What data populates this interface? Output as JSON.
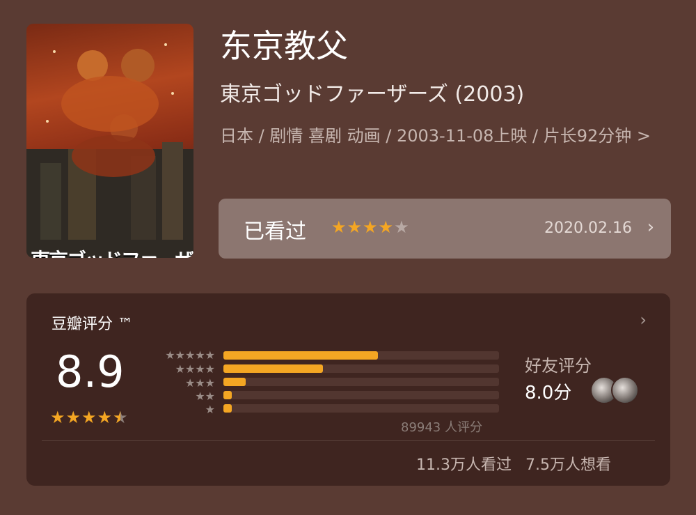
{
  "movie": {
    "title": "东京教父",
    "original_title": "東京ゴッドファーザーズ (2003)",
    "meta": "日本 / 剧情 喜剧 动画 / 2003-11-08上映 / 片长92分钟 >",
    "poster_title": "東京ゴッドファーザーズ"
  },
  "watched": {
    "label": "已看过",
    "stars": 4,
    "date": "2020.02.16",
    "chevron": "›"
  },
  "rating": {
    "title": "豆瓣评分 ™",
    "score": "8.9",
    "stars": 4.5,
    "chevron": "›",
    "distribution": [
      {
        "stars": "★★★★★",
        "fraction": 0.56
      },
      {
        "stars": "★★★★",
        "fraction": 0.36
      },
      {
        "stars": "★★★",
        "fraction": 0.08
      },
      {
        "stars": "★★",
        "fraction": 0.03
      },
      {
        "stars": "★",
        "fraction": 0.03
      }
    ],
    "count": "89943 人评分",
    "friends_label": "好友评分",
    "friends_score": "8.0分",
    "watched_count": "11.3万人看过",
    "want_count": "7.5万人想看"
  },
  "colors": {
    "background": "#5a3b33",
    "card": "#3f2520",
    "accent": "#f4a623"
  }
}
